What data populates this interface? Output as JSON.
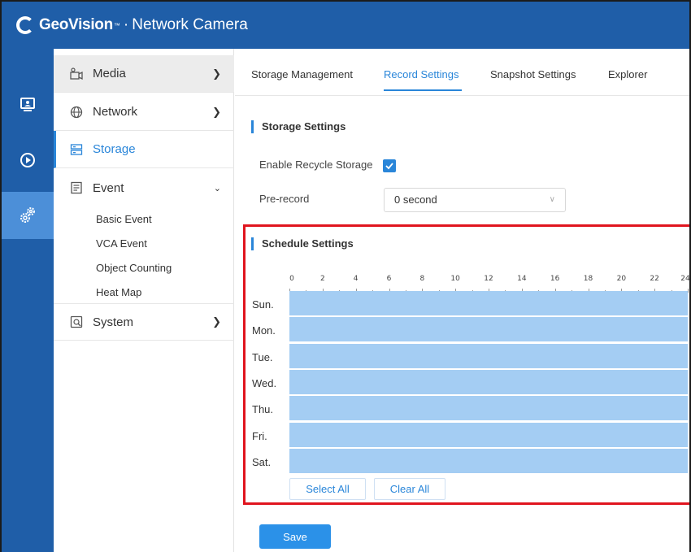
{
  "header": {
    "brand": "GeoVision",
    "tm": "™",
    "dot": "·",
    "product": "Network Camera"
  },
  "rail": {
    "items": [
      {
        "icon": "monitor-icon"
      },
      {
        "icon": "playback-icon"
      },
      {
        "icon": "settings-gears-icon"
      }
    ]
  },
  "nav": {
    "media": "Media",
    "network": "Network",
    "storage": "Storage",
    "event": "Event",
    "event_children": [
      "Basic Event",
      "VCA Event",
      "Object Counting",
      "Heat Map"
    ],
    "system": "System"
  },
  "tabs": [
    "Storage Management",
    "Record Settings",
    "Snapshot Settings",
    "Explorer"
  ],
  "storage_settings": {
    "title": "Storage Settings",
    "recycle_label": "Enable Recycle Storage",
    "recycle_checked": true,
    "prerecord_label": "Pre-record",
    "prerecord_value": "0 second"
  },
  "schedule": {
    "title": "Schedule Settings",
    "hours": [
      "0",
      "2",
      "4",
      "6",
      "8",
      "10",
      "12",
      "14",
      "16",
      "18",
      "20",
      "22",
      "24"
    ],
    "days": [
      "Sun.",
      "Mon.",
      "Tue.",
      "Wed.",
      "Thu.",
      "Fri.",
      "Sat."
    ],
    "select_all": "Select All",
    "clear_all": "Clear All"
  },
  "actions": {
    "save": "Save"
  },
  "colors": {
    "header": "#1f5ea8",
    "accent": "#2a86d9",
    "schedule_fill": "#a4cdf3",
    "highlight": "#e0141e"
  }
}
